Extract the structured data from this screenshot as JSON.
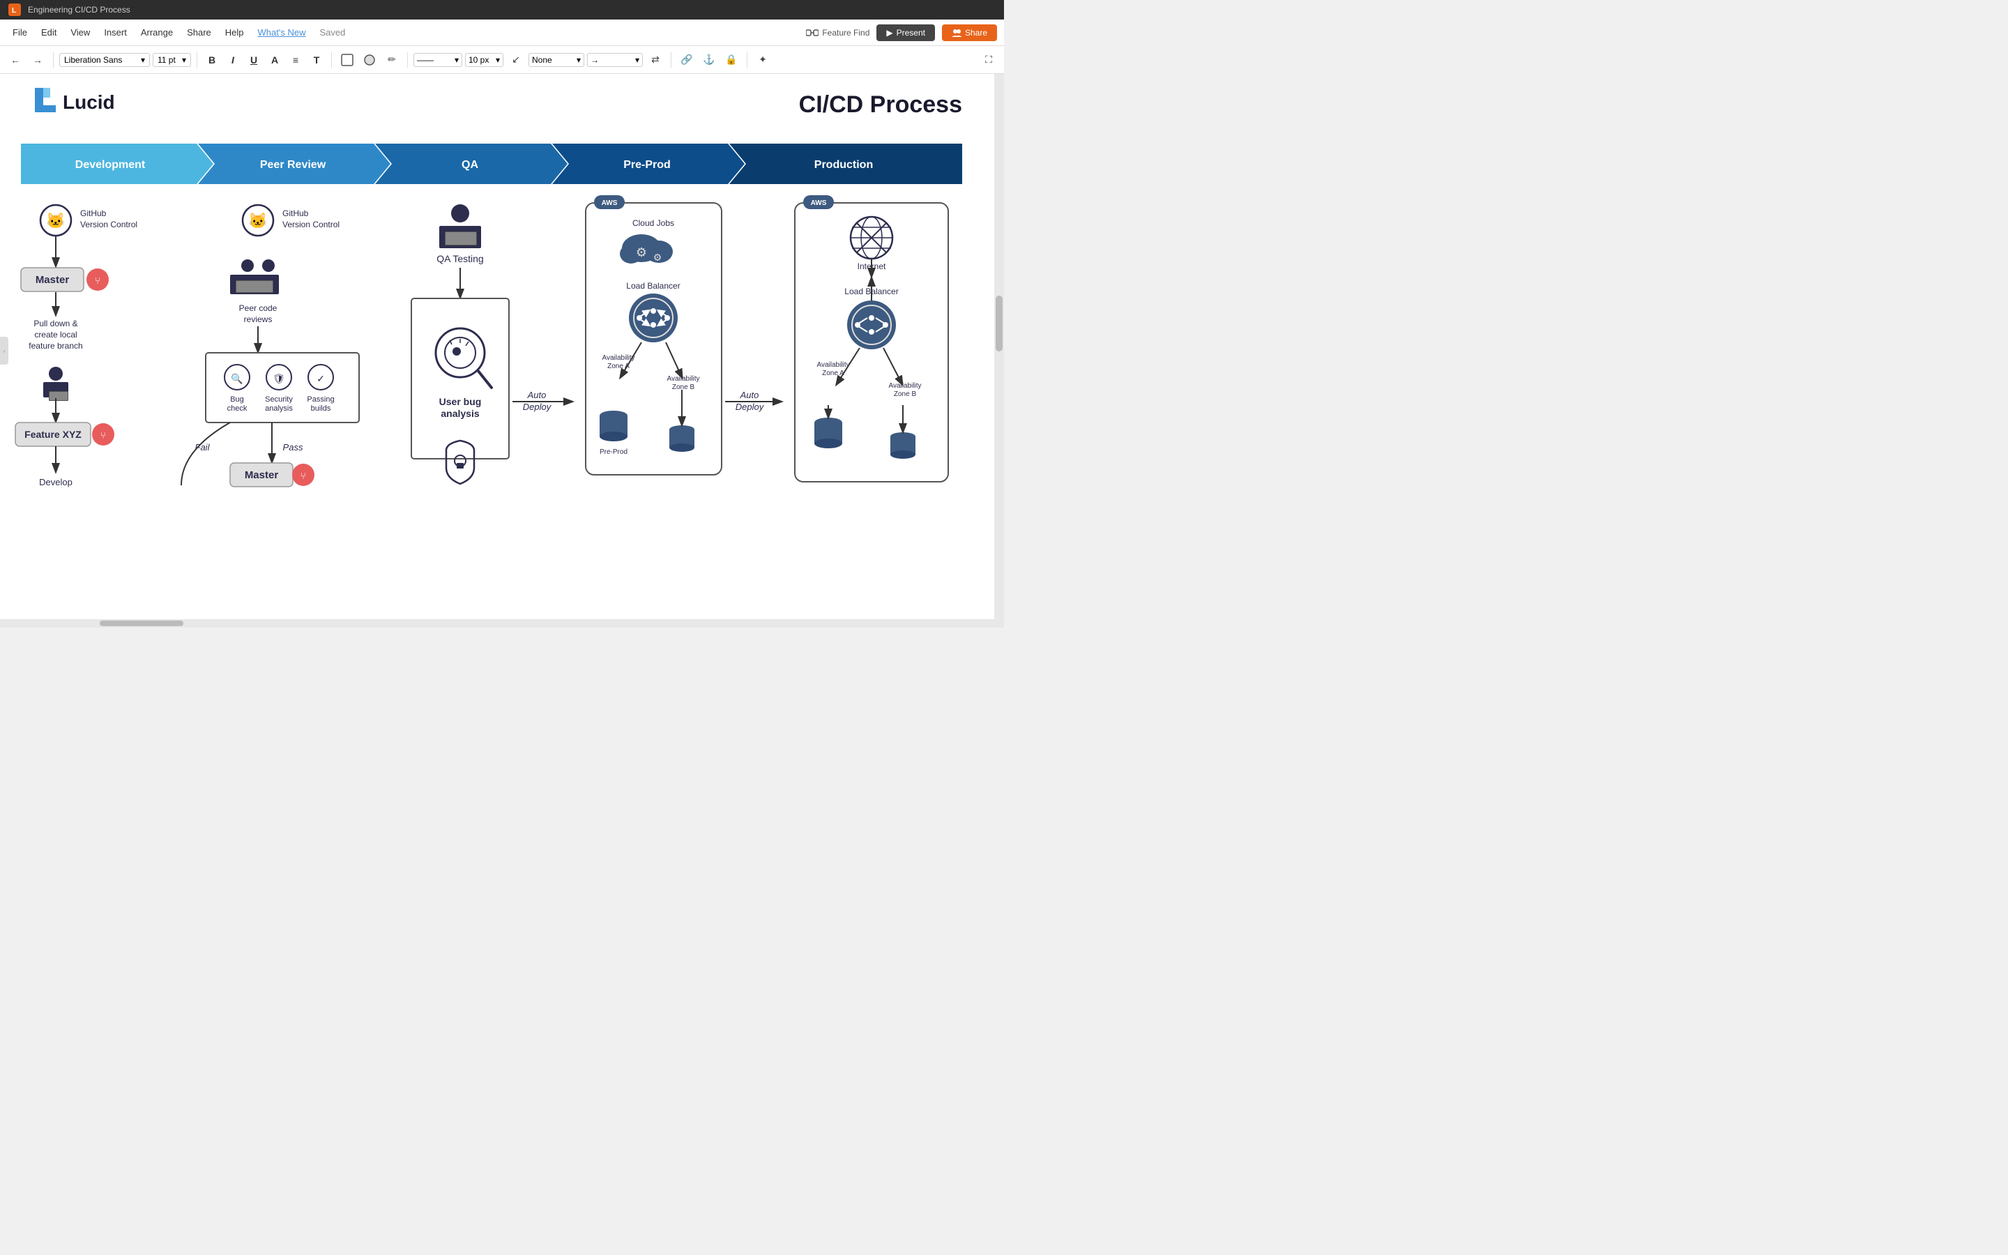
{
  "titlebar": {
    "app_icon": "L",
    "title": "Engineering CI/CD Process"
  },
  "menubar": {
    "items": [
      {
        "label": "File",
        "active": false
      },
      {
        "label": "Edit",
        "active": false
      },
      {
        "label": "View",
        "active": false
      },
      {
        "label": "Insert",
        "active": false
      },
      {
        "label": "Arrange",
        "active": false
      },
      {
        "label": "Share",
        "active": false
      },
      {
        "label": "Help",
        "active": false
      },
      {
        "label": "What's New",
        "active": true
      },
      {
        "label": "Saved",
        "active": false
      }
    ],
    "feature_find": "Feature Find",
    "present_label": "Present",
    "share_label": "Share"
  },
  "toolbar": {
    "font_family": "Liberation Sans",
    "font_size": "11 pt",
    "line_style": "——",
    "px_value": "10 px",
    "none_value": "None"
  },
  "diagram": {
    "title": "CI/CD Process",
    "logo_text": "Lucid",
    "phases": [
      {
        "label": "Development",
        "color": "#4db6e0"
      },
      {
        "label": "Peer Review",
        "color": "#2e88c8"
      },
      {
        "label": "QA",
        "color": "#1a68a8"
      },
      {
        "label": "Pre-Prod",
        "color": "#0d4d8a"
      },
      {
        "label": "Production",
        "color": "#0a3d6e"
      }
    ],
    "dev_column": {
      "github_label": "GitHub\nVersion Control",
      "master_label": "Master",
      "pull_down_text": "Pull down &\ncreate local\nfeature branch",
      "feature_label": "Feature XYZ",
      "develop_label": "Develop"
    },
    "peer_column": {
      "github_label": "GitHub\nVersion Control",
      "peer_review_text": "Peer code\nreviews",
      "bug_check_label": "Bug\ncheck",
      "security_label": "Security\nanalysis",
      "passing_label": "Passing\nbuilds",
      "fail_label": "Fail",
      "pass_label": "Pass",
      "master_label": "Master"
    },
    "qa_column": {
      "qa_testing_label": "QA Testing",
      "user_bug_label": "User bug\nanalysis"
    },
    "preprod_column": {
      "aws_label": "AWS",
      "cloud_jobs_label": "Cloud Jobs",
      "load_balancer_label": "Load Balancer",
      "avail_zone_a": "Availability\nZone A",
      "avail_zone_b": "Availability\nZone B",
      "auto_deploy": "Auto\nDeploy",
      "preprod_label": "Pre-Prod"
    },
    "production_column": {
      "aws_label": "AWS",
      "internet_label": "Internet",
      "load_balancer_label": "Load Balancer",
      "avail_zone_a": "Availability\nZone A",
      "avail_zone_b": "Availability\nZone B",
      "auto_deploy": "Auto\nDeploy"
    }
  }
}
